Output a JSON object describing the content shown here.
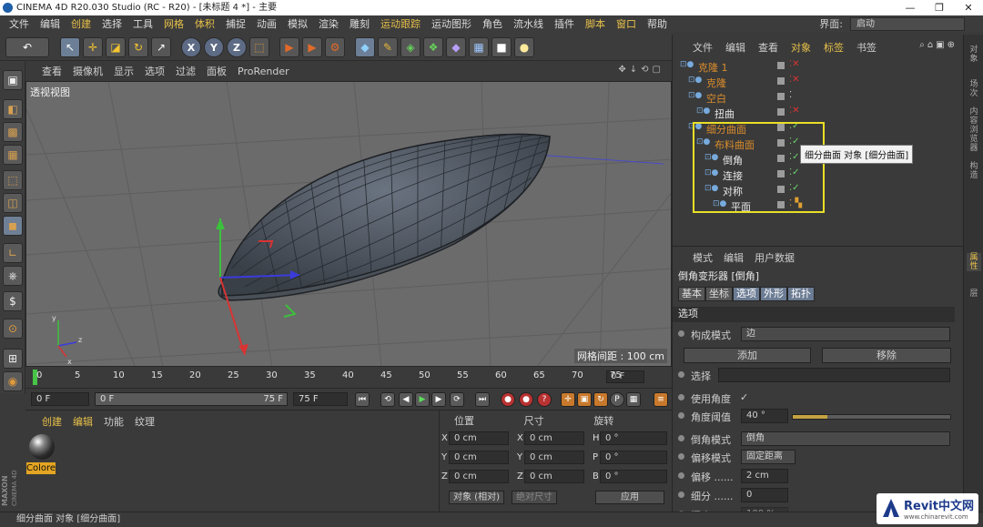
{
  "window": {
    "title": "CINEMA 4D R20.030 Studio (RC - R20) - [未标题 4 *] - 主要"
  },
  "menu": [
    "文件",
    "编辑",
    "创建",
    "选择",
    "工具",
    "网格",
    "体积",
    "捕捉",
    "动画",
    "模拟",
    "渲染",
    "雕刻",
    "运动跟踪",
    "运动图形",
    "角色",
    "流水线",
    "插件",
    "脚本",
    "窗口",
    "帮助"
  ],
  "menu_highlight": [
    "创建",
    "网格",
    "体积",
    "运动跟踪",
    "脚本",
    "窗口"
  ],
  "layout": {
    "label": "界面:",
    "value": "启动"
  },
  "viewport": {
    "menu": [
      "查看",
      "摄像机",
      "显示",
      "选项",
      "过滤",
      "面板",
      "ProRender"
    ],
    "label": "透视视图",
    "grid_spacing": "网格间距 : 100 cm"
  },
  "timeline": {
    "ticks": [
      "0",
      "5",
      "10",
      "15",
      "20",
      "25",
      "30",
      "35",
      "40",
      "45",
      "50",
      "55",
      "60",
      "65",
      "70",
      "75"
    ],
    "current_frame": "0 F"
  },
  "transport": {
    "start": "0 F",
    "range_start": "0 F",
    "range_end": "75 F",
    "end": "75 F"
  },
  "materials": {
    "tabs": [
      "创建",
      "编辑",
      "功能",
      "纹理"
    ],
    "highlighted_tabs": [
      "创建",
      "编辑"
    ],
    "items": [
      {
        "name": "Colore"
      }
    ]
  },
  "coordinates": {
    "headers": [
      "位置",
      "尺寸",
      "旋转"
    ],
    "rows": [
      {
        "axis": "X",
        "pos": "0 cm",
        "size_axis": "X",
        "size": "0 cm",
        "rot_axis": "H",
        "rot": "0 °"
      },
      {
        "axis": "Y",
        "pos": "0 cm",
        "size_axis": "Y",
        "size": "0 cm",
        "rot_axis": "P",
        "rot": "0 °"
      },
      {
        "axis": "Z",
        "pos": "0 cm",
        "size_axis": "Z",
        "size": "0 cm",
        "rot_axis": "B",
        "rot": "0 °"
      }
    ],
    "mode": "对象 (相对)",
    "size_mode": "绝对尺寸",
    "apply": "应用"
  },
  "object_manager": {
    "tabs": [
      "文件",
      "编辑",
      "查看",
      "对象",
      "标签",
      "书签"
    ],
    "highlighted_tabs": [
      "对象",
      "标签"
    ],
    "objects": [
      {
        "name": "克隆 1",
        "color": "orange",
        "indent": 0,
        "status": "x"
      },
      {
        "name": "克隆",
        "color": "orange",
        "indent": 1,
        "status": "x"
      },
      {
        "name": "空白",
        "color": "orange",
        "indent": 1,
        "status": ":"
      },
      {
        "name": "扭曲",
        "color": "white",
        "indent": 2,
        "status": "x"
      },
      {
        "name": "细分曲面",
        "color": "orange",
        "indent": 1,
        "status": "check"
      },
      {
        "name": "布料曲面",
        "color": "orange",
        "indent": 2,
        "status": "check"
      },
      {
        "name": "倒角",
        "color": "white",
        "indent": 3,
        "status": "check"
      },
      {
        "name": "连接",
        "color": "white",
        "indent": 3,
        "status": "check"
      },
      {
        "name": "对称",
        "color": "white",
        "indent": 3,
        "status": "check"
      },
      {
        "name": "平面",
        "color": "white",
        "indent": 4,
        "status": "tag"
      }
    ],
    "tooltip": "细分曲面 对象 [细分曲面]"
  },
  "attributes": {
    "tabs": [
      "模式",
      "编辑",
      "用户数据"
    ],
    "title": "倒角变形器 [倒角]",
    "subtabs": [
      "基本",
      "坐标",
      "选项",
      "外形",
      "拓扑"
    ],
    "selected_subtabs": [
      "选项",
      "外形",
      "拓扑"
    ],
    "section": "选项",
    "build_mode": {
      "label": "构成模式",
      "value": "边"
    },
    "add_btn": "添加",
    "remove_btn": "移除",
    "selection": {
      "label": "选择",
      "value": ""
    },
    "use_angle": {
      "label": "使用角度",
      "value": "✓"
    },
    "angle_threshold": {
      "label": "角度阈值",
      "value": "40 °",
      "fraction": 0.22
    },
    "bevel_mode": {
      "label": "倒角模式",
      "value": "倒角"
    },
    "offset_mode": {
      "label": "偏移模式",
      "value": "固定距离"
    },
    "offset": {
      "label": "偏移 ......",
      "value": "2 cm"
    },
    "subdiv": {
      "label": "细分 ......",
      "value": "0"
    },
    "depth": {
      "label": "深度 ......",
      "value": "100 %"
    }
  },
  "right_strip": [
    {
      "label": "对象",
      "hl": false
    },
    {
      "label": "场次",
      "hl": false
    },
    {
      "label": "内容浏览器",
      "hl": false
    },
    {
      "label": "构造",
      "hl": false
    },
    {
      "label": "属性",
      "hl": true
    },
    {
      "label": "层",
      "hl": false
    }
  ],
  "status_bar": "细分曲面 对象 [细分曲面]",
  "watermark": {
    "brand": "Revit中文网",
    "url": "www.chinarevit.com"
  },
  "colors": {
    "accent": "#e7c04a",
    "highlight_box": "#e9df27",
    "material": "#e4a522"
  }
}
